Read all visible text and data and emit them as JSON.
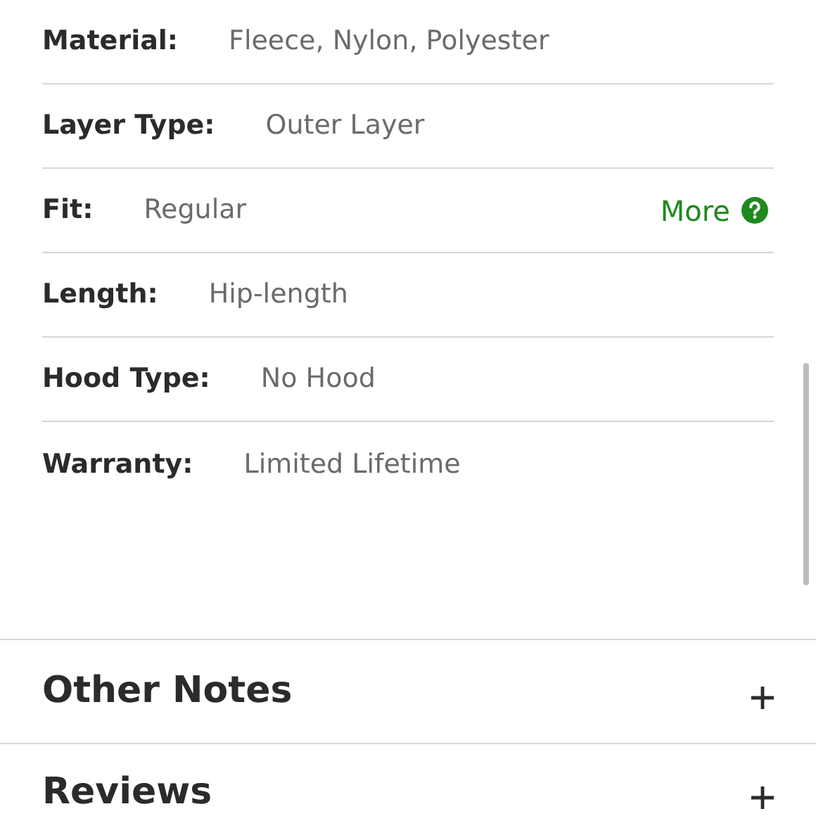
{
  "specs": [
    {
      "label": "Material:",
      "value": "Fleece, Nylon, Polyester"
    },
    {
      "label": "Layer Type:",
      "value": "Outer Layer"
    },
    {
      "label": "Fit:",
      "value": "Regular",
      "link": "More"
    },
    {
      "label": "Length:",
      "value": "Hip-length"
    },
    {
      "label": "Hood Type:",
      "value": "No Hood"
    },
    {
      "label": "Warranty:",
      "value": "Limited Lifetime"
    }
  ],
  "sections": [
    {
      "title": "Other Notes",
      "expanded": false
    },
    {
      "title": "Reviews",
      "expanded": false
    }
  ]
}
